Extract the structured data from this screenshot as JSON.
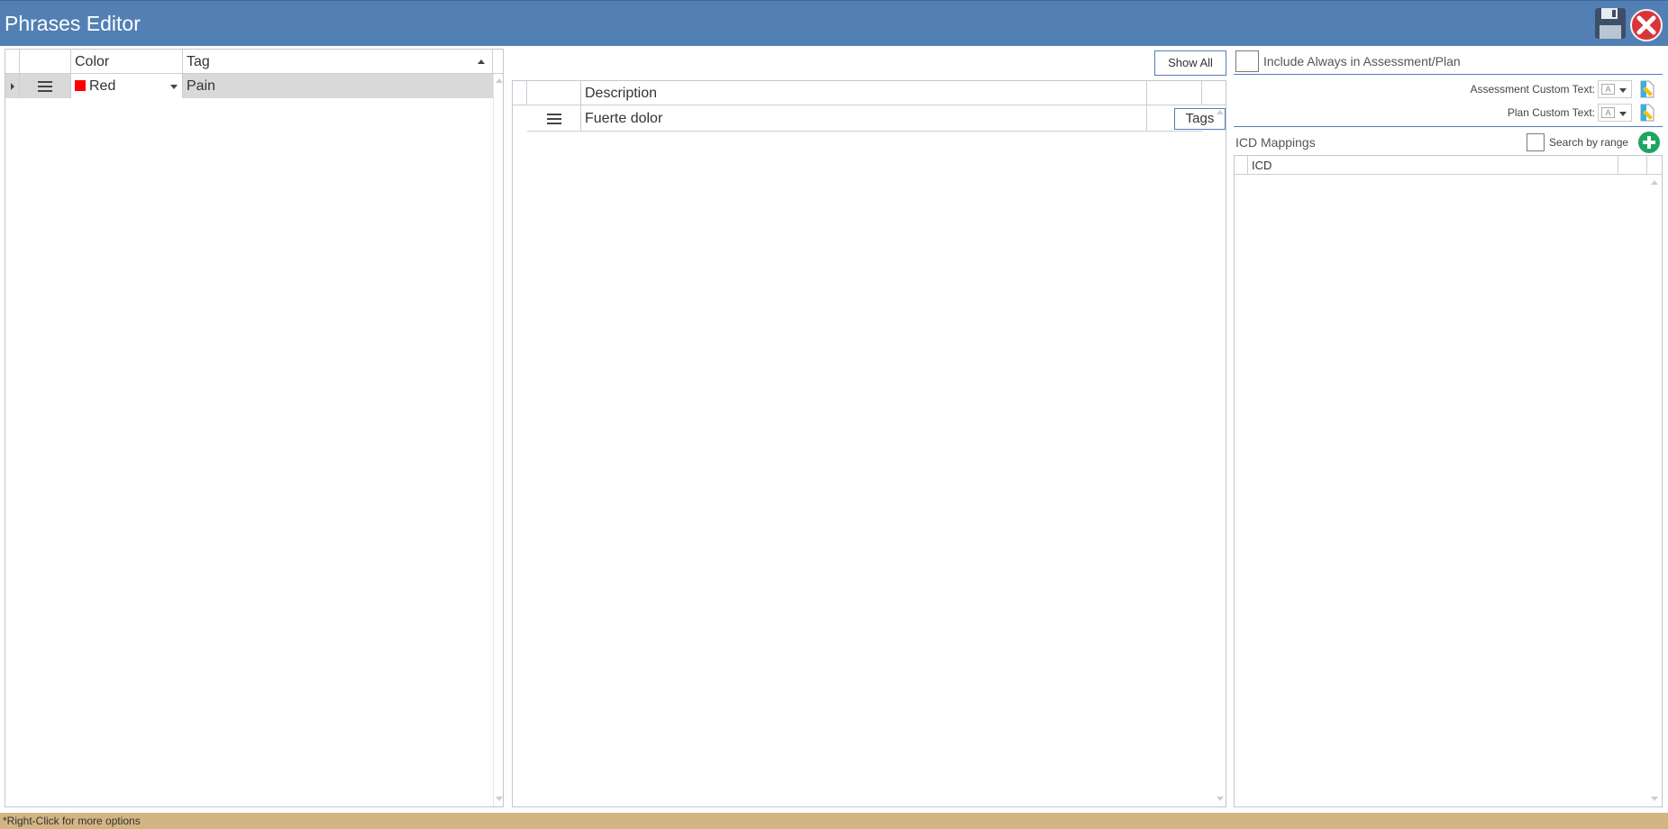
{
  "window": {
    "title": "Phrases Editor"
  },
  "toolbar": {
    "save_icon": "floppy-disk-icon",
    "close_icon": "close-x-icon"
  },
  "tags_grid": {
    "columns": {
      "color": "Color",
      "tag": "Tag"
    },
    "rows": [
      {
        "color_name": "Red",
        "color_hex": "#ff0000",
        "tag": "Pain"
      }
    ]
  },
  "phrases_grid": {
    "show_all_label": "Show All",
    "columns": {
      "description": "Description"
    },
    "rows": [
      {
        "description": "Fuerte dolor",
        "tags_button": "Tags"
      }
    ]
  },
  "options": {
    "include_always_label": "Include Always in Assessment/Plan",
    "assessment_custom_text_label": "Assessment Custom Text:",
    "plan_custom_text_label": "Plan Custom Text:",
    "icd_mappings_label": "ICD Mappings",
    "search_by_range_label": "Search by range",
    "icd_column": "ICD"
  },
  "status": {
    "hint": "*Right-Click for more options"
  },
  "colors": {
    "titlebar": "#5280b5",
    "status_bar": "#d3b483",
    "add_button": "#1fa463"
  }
}
